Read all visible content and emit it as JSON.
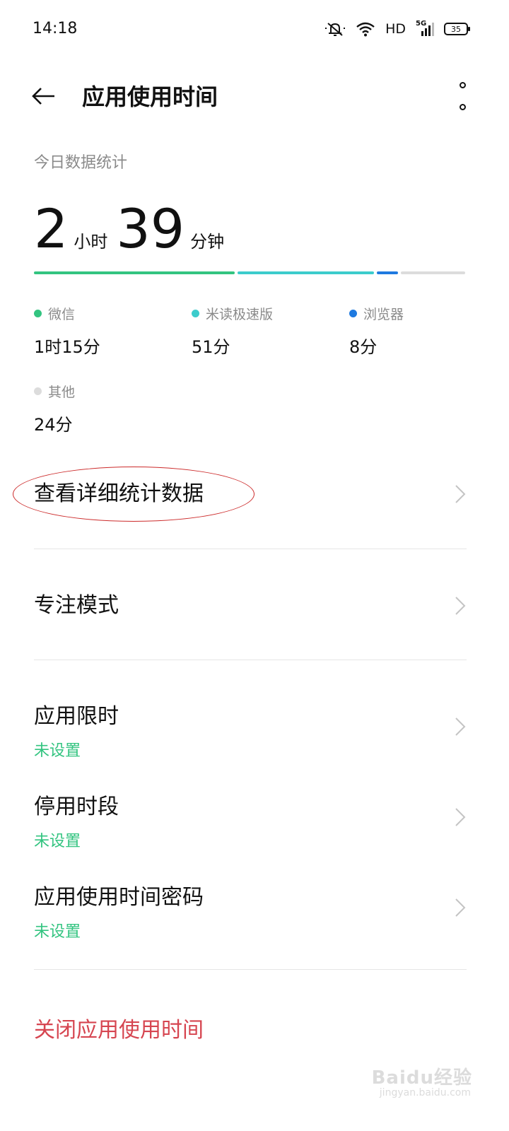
{
  "status_bar": {
    "time": "14:18",
    "network_label": "HD",
    "signal_label": "5G",
    "battery": "35",
    "icons": [
      "mute-icon",
      "wifi-icon",
      "signal-icon",
      "battery-icon"
    ]
  },
  "header": {
    "title": "应用使用时间",
    "icons": [
      "back-arrow-icon",
      "more-vertical-icon"
    ]
  },
  "stats": {
    "section_title": "今日数据统计",
    "hours": "2",
    "hours_unit": "小时",
    "minutes": "39",
    "minutes_unit": "分钟",
    "apps": [
      {
        "name": "微信",
        "time": "1时15分",
        "minutes": 75,
        "color": "#33c480"
      },
      {
        "name": "米读极速版",
        "time": "51分",
        "minutes": 51,
        "color": "#3ccccc"
      },
      {
        "name": "浏览器",
        "time": "8分",
        "minutes": 8,
        "color": "#1e7ae0"
      },
      {
        "name": "其他",
        "time": "24分",
        "minutes": 24,
        "color": "#dcdcdc"
      }
    ]
  },
  "menu": {
    "detail_stats": "查看详细统计数据",
    "focus_mode": "专注模式",
    "app_limit": {
      "label": "应用限时",
      "status": "未设置"
    },
    "downtime": {
      "label": "停用时段",
      "status": "未设置"
    },
    "passcode": {
      "label": "应用使用时间密码",
      "status": "未设置"
    },
    "close": "关闭应用使用时间"
  },
  "watermark": {
    "brand": "Baidu经验",
    "url": "jingyan.baidu.com"
  },
  "colors": {
    "accent_green": "#33c480",
    "danger_red": "#d64550",
    "annotation_red": "#cc2a2a"
  }
}
